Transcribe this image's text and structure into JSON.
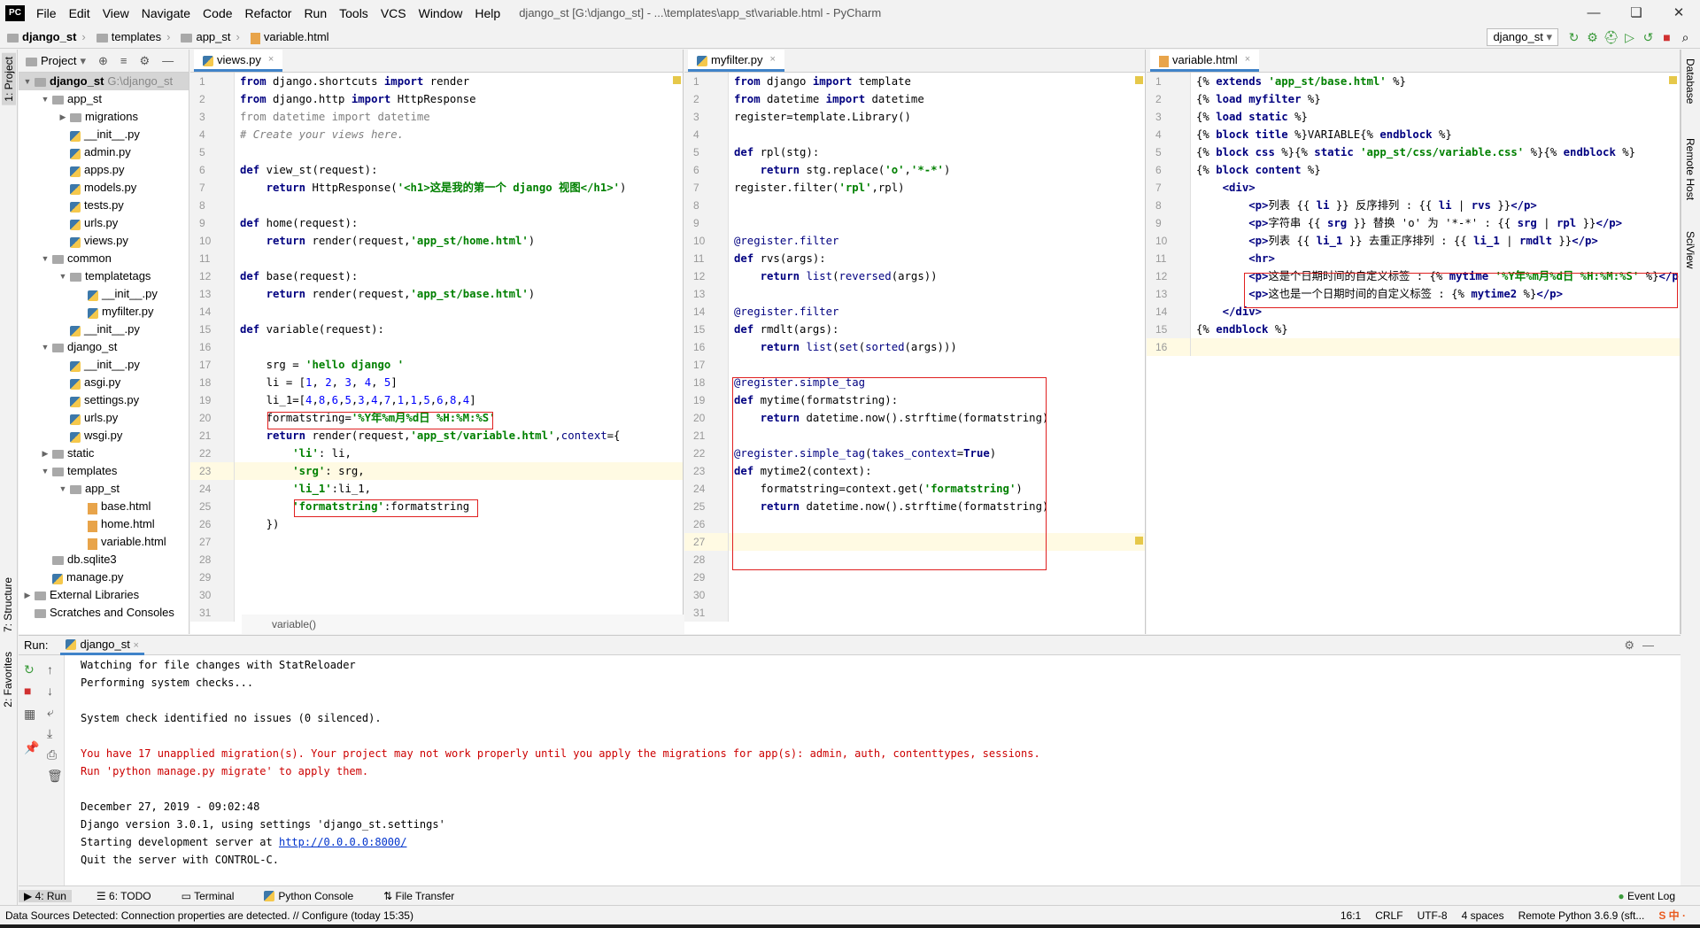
{
  "menubar": {
    "logo": "PC",
    "items": [
      "File",
      "Edit",
      "View",
      "Navigate",
      "Code",
      "Refactor",
      "Run",
      "Tools",
      "VCS",
      "Window",
      "Help"
    ],
    "title": "django_st [G:\\django_st] - ...\\templates\\app_st\\variable.html - PyCharm",
    "win": [
      "—",
      "❏",
      "✕"
    ]
  },
  "breadcrumb": [
    "django_st",
    "templates",
    "app_st",
    "variable.html"
  ],
  "runconfig": "django_st",
  "toolbar_icons": [
    "↻",
    "⚙",
    "⛑",
    "▷",
    "↺",
    "■",
    "⌕"
  ],
  "left_tabs": [
    "1: Project",
    "7: Structure",
    "2: Favorites"
  ],
  "right_tabs": [
    "Database",
    "Remote Host",
    "SciView"
  ],
  "project": {
    "label": "Project",
    "icons": [
      "⊕",
      "≡",
      "⚙",
      "—"
    ],
    "tree": [
      {
        "d": 0,
        "a": "▼",
        "i": "folder",
        "t": "django_st",
        "dim": "G:\\django_st",
        "sel": true
      },
      {
        "d": 1,
        "a": "▼",
        "i": "folder",
        "t": "app_st"
      },
      {
        "d": 2,
        "a": "▶",
        "i": "folder",
        "t": "migrations"
      },
      {
        "d": 2,
        "a": "",
        "i": "py",
        "t": "__init__.py"
      },
      {
        "d": 2,
        "a": "",
        "i": "py",
        "t": "admin.py"
      },
      {
        "d": 2,
        "a": "",
        "i": "py",
        "t": "apps.py"
      },
      {
        "d": 2,
        "a": "",
        "i": "py",
        "t": "models.py"
      },
      {
        "d": 2,
        "a": "",
        "i": "py",
        "t": "tests.py"
      },
      {
        "d": 2,
        "a": "",
        "i": "py",
        "t": "urls.py"
      },
      {
        "d": 2,
        "a": "",
        "i": "py",
        "t": "views.py"
      },
      {
        "d": 1,
        "a": "▼",
        "i": "folder",
        "t": "common"
      },
      {
        "d": 2,
        "a": "▼",
        "i": "folder",
        "t": "templatetags"
      },
      {
        "d": 3,
        "a": "",
        "i": "py",
        "t": "__init__.py"
      },
      {
        "d": 3,
        "a": "",
        "i": "py",
        "t": "myfilter.py"
      },
      {
        "d": 2,
        "a": "",
        "i": "py",
        "t": "__init__.py"
      },
      {
        "d": 1,
        "a": "▼",
        "i": "folder",
        "t": "django_st"
      },
      {
        "d": 2,
        "a": "",
        "i": "py",
        "t": "__init__.py"
      },
      {
        "d": 2,
        "a": "",
        "i": "py",
        "t": "asgi.py"
      },
      {
        "d": 2,
        "a": "",
        "i": "py",
        "t": "settings.py"
      },
      {
        "d": 2,
        "a": "",
        "i": "py",
        "t": "urls.py"
      },
      {
        "d": 2,
        "a": "",
        "i": "py",
        "t": "wsgi.py"
      },
      {
        "d": 1,
        "a": "▶",
        "i": "folder",
        "t": "static"
      },
      {
        "d": 1,
        "a": "▼",
        "i": "folder",
        "t": "templates"
      },
      {
        "d": 2,
        "a": "▼",
        "i": "folder",
        "t": "app_st"
      },
      {
        "d": 3,
        "a": "",
        "i": "html",
        "t": "base.html"
      },
      {
        "d": 3,
        "a": "",
        "i": "html",
        "t": "home.html"
      },
      {
        "d": 3,
        "a": "",
        "i": "html",
        "t": "variable.html"
      },
      {
        "d": 1,
        "a": "",
        "i": "db",
        "t": "db.sqlite3"
      },
      {
        "d": 1,
        "a": "",
        "i": "py",
        "t": "manage.py"
      },
      {
        "d": 0,
        "a": "▶",
        "i": "lib",
        "t": "External Libraries"
      },
      {
        "d": 0,
        "a": "",
        "i": "scratch",
        "t": "Scratches and Consoles"
      }
    ]
  },
  "editors": [
    {
      "tab": "views.py",
      "icon": "py",
      "breadcrumb": "variable()",
      "hl": [
        23
      ],
      "lines": [
        "<span class='kw'>from</span> django.shortcuts <span class='kw'>import</span> render",
        "<span class='kw'>from</span> django.http <span class='kw'>import</span> HttpResponse",
        "<span class='gr'>from datetime import datetime</span>",
        "<span class='cm'># Create your views here.</span>",
        "",
        "<span class='kw'>def</span> view_st(request):",
        "    <span class='kw'>return</span> HttpResponse(<span class='st'>'&lt;h1&gt;这是我的第一个 django 视图&lt;/h1&gt;'</span>)",
        "",
        "<span class='kw'>def</span> home(request):",
        "    <span class='kw'>return</span> render(request,<span class='st'>'app_st/home.html'</span>)",
        "",
        "<span class='kw'>def</span> base(request):",
        "    <span class='kw'>return</span> render(request,<span class='st'>'app_st/base.html'</span>)",
        "",
        "<span class='kw'>def</span> variable(request):",
        "",
        "    srg = <span class='st'>'hello django '</span>",
        "    li = [<span class='nm'>1</span>, <span class='nm'>2</span>, <span class='nm'>3</span>, <span class='nm'>4</span>, <span class='nm'>5</span>]",
        "    li_1=[<span class='nm'>4</span>,<span class='nm'>8</span>,<span class='nm'>6</span>,<span class='nm'>5</span>,<span class='nm'>3</span>,<span class='nm'>4</span>,<span class='nm'>7</span>,<span class='nm'>1</span>,<span class='nm'>1</span>,<span class='nm'>5</span>,<span class='nm'>6</span>,<span class='nm'>8</span>,<span class='nm'>4</span>]",
        "    formatstring=<span class='st'>'%Y年%m月%d日 %H:%M:%S'</span>",
        "    <span class='kw'>return</span> render(request,<span class='st'>'app_st/variable.html'</span>,<span class='dc'>context</span>={",
        "        <span class='st'>'li'</span>: li,",
        "        <span class='st'>'srg'</span>: srg,",
        "        <span class='st'>'li_1'</span>:li_1,",
        "        <span class='st'>'formatstring'</span>:formatstring",
        "    })",
        "",
        "",
        "",
        "",
        ""
      ]
    },
    {
      "tab": "myfilter.py",
      "icon": "py",
      "hl": [
        27
      ],
      "lines": [
        "<span class='kw'>from</span> django <span class='kw'>import</span> template",
        "<span class='kw'>from</span> datetime <span class='kw'>import</span> datetime",
        "register=template.Library()",
        "",
        "<span class='kw'>def</span> rpl(stg):",
        "    <span class='kw'>return</span> stg.replace(<span class='st'>'o'</span>,<span class='st'>'*-*'</span>)",
        "register.filter(<span class='st'>'rpl'</span>,rpl)",
        "",
        "",
        "<span class='dc'>@register.filter</span>",
        "<span class='kw'>def</span> rvs(args):",
        "    <span class='kw'>return</span> <span class='dc'>list</span>(<span class='dc'>reversed</span>(args))",
        "",
        "<span class='dc'>@register.filter</span>",
        "<span class='kw'>def</span> rmdlt(args):",
        "    <span class='kw'>return</span> <span class='dc'>list</span>(<span class='dc'>set</span>(<span class='dc'>sorted</span>(args)))",
        "",
        "<span class='dc'>@register.simple_tag</span>",
        "<span class='kw'>def</span> mytime(formatstring):",
        "    <span class='kw'>return</span> datetime.now().strftime(formatstring)",
        "",
        "<span class='dc'>@register.simple_tag</span>(<span class='dc'>takes_context</span>=<span class='kw'>True</span>)",
        "<span class='kw'>def</span> mytime2(context):",
        "    formatstring=context.get(<span class='st'>'formatstring'</span>)",
        "    <span class='kw'>return</span> datetime.now().strftime(formatstring)",
        "",
        "",
        "",
        "",
        "",
        ""
      ]
    },
    {
      "tab": "variable.html",
      "icon": "html",
      "hl": [
        16
      ],
      "lines": [
        "{% <span class='tv'>extends</span> <span class='st'>'app_st/base.html'</span> %}",
        "{% <span class='tv'>load</span> <span class='tv'>myfilter</span> %}",
        "{% <span class='tv'>load</span> <span class='tv'>static</span> %}",
        "{% <span class='tv'>block</span> <span class='tv'>title</span> %}VARIABLE{% <span class='tv'>endblock</span> %}",
        "{% <span class='tv'>block</span> <span class='tv'>css</span> %}{% <span class='tv'>static</span> <span class='st'>'app_st/css/variable.css'</span> %}{% <span class='tv'>endblock</span> %}",
        "{% <span class='tv'>block</span> <span class='tv'>content</span> %}",
        "    <span class='tg'>&lt;div&gt;</span>",
        "        <span class='tg'>&lt;p&gt;</span>列表 {{ <span class='tv'>li</span> }} 反序排列 : {{ <span class='tv'>li</span> | <span class='tv'>rvs</span> }}<span class='tg'>&lt;/p&gt;</span>",
        "        <span class='tg'>&lt;p&gt;</span>字符串 {{ <span class='tv'>srg</span> }} 替换 'o' 为 '*-*' : {{ <span class='tv'>srg</span> | <span class='tv'>rpl</span> }}<span class='tg'>&lt;/p&gt;</span>",
        "        <span class='tg'>&lt;p&gt;</span>列表 {{ <span class='tv'>li_1</span> }} 去重正序排列 : {{ <span class='tv'>li_1</span> | <span class='tv'>rmdlt</span> }}<span class='tg'>&lt;/p&gt;</span>",
        "        <span class='tg'>&lt;hr&gt;</span>",
        "        <span class='tg'>&lt;p&gt;</span>这是个日期时间的自定义标签 : {% <span class='tv'>mytime</span> <span class='st'>'%Y年%m月%d日 %H:%M:%S'</span> %}<span class='tg'>&lt;/p</span>",
        "        <span class='tg'>&lt;p&gt;</span>这也是一个日期时间的自定义标签 : {% <span class='tv'>mytime2</span> %}<span class='tg'>&lt;/p&gt;</span>",
        "    <span class='tg'>&lt;/div&gt;</span>",
        "{% <span class='tv'>endblock</span> %}",
        ""
      ]
    }
  ],
  "run": {
    "label": "Run:",
    "config": "django_st",
    "output": [
      {
        "t": "Watching for file changes with StatReloader",
        "c": ""
      },
      {
        "t": "Performing system checks...",
        "c": ""
      },
      {
        "t": "",
        "c": ""
      },
      {
        "t": "System check identified no issues (0 silenced).",
        "c": ""
      },
      {
        "t": "",
        "c": ""
      },
      {
        "t": "You have 17 unapplied migration(s). Your project may not work properly until you apply the migrations for app(s): admin, auth, contenttypes, sessions.",
        "c": "err"
      },
      {
        "t": "Run 'python manage.py migrate' to apply them.",
        "c": "err"
      },
      {
        "t": "",
        "c": ""
      },
      {
        "t": "December 27, 2019 - 09:02:48",
        "c": ""
      },
      {
        "t": "Django version 3.0.1, using settings 'django_st.settings'",
        "c": ""
      },
      {
        "t": "Starting development server at ",
        "c": "",
        "link": "http://0.0.0.0:8000/"
      },
      {
        "t": "Quit the server with CONTROL-C.",
        "c": ""
      }
    ]
  },
  "bottom_tabs": [
    "4: Run",
    "6: TODO",
    "Terminal",
    "Python Console",
    "File Transfer"
  ],
  "event_log": "Event Log",
  "status": {
    "message": "Data Sources Detected: Connection properties are detected. // Configure (today 15:35)",
    "pos": "16:1",
    "eol": "CRLF",
    "enc": "UTF-8",
    "indent": "4 spaces",
    "interp": "Remote Python 3.6.9 (sft..."
  }
}
